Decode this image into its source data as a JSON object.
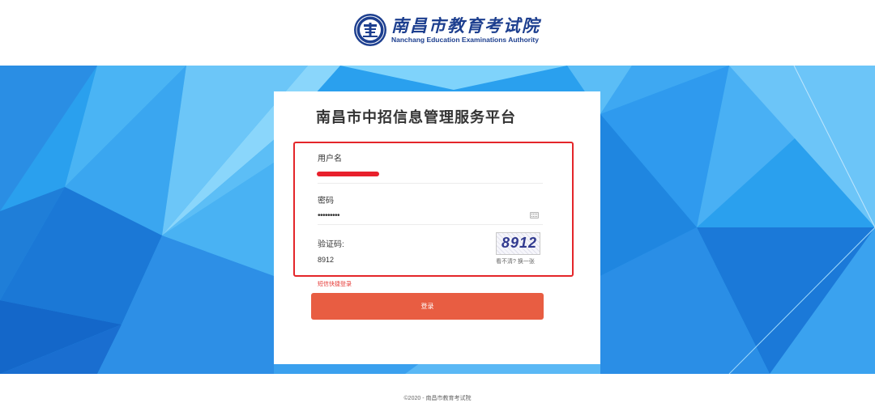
{
  "header": {
    "logo_cn": "南昌市教育考试院",
    "logo_en": "Nanchang Education Examinations Authority"
  },
  "login": {
    "title": "南昌市中招信息管理服务平台",
    "username_label": "用户名",
    "password_label": "密码",
    "password_value": "•••••••••",
    "captcha_label": "验证码:",
    "captcha_value": "8912",
    "captcha_image_text": "8912",
    "captcha_refresh": "看不清? 换一张",
    "sms_login_link": "短信快捷登录",
    "login_button": "登录"
  },
  "footer": {
    "copyright": "©2020 - 南昌市教育考试院"
  },
  "colors": {
    "brand_blue": "#1d3f8f",
    "login_button": "#e85d42",
    "highlight_box": "#e4262a"
  }
}
